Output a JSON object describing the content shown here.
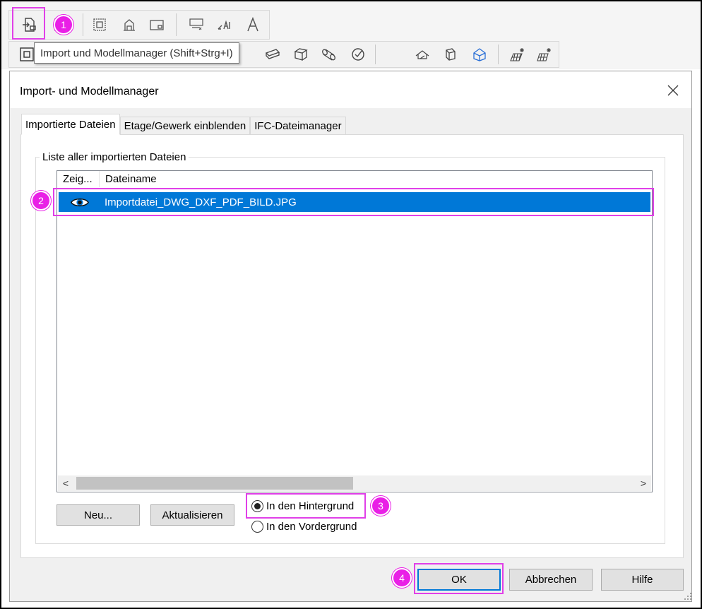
{
  "toolbar": {
    "tooltip": "Import und Modellmanager (Shift+Strg+I)",
    "row1_icons": [
      "import-icon",
      "copy-frame-icon",
      "floor-plan-icon",
      "frame-icon",
      "number-icon",
      "dimension-text-icon",
      "text-icon"
    ],
    "row2_icons": [
      "stamp-icon",
      "beam-icon",
      "box-icon",
      "cylinder-icon",
      "check-icon",
      "roof-icon",
      "cube-icon",
      "cut-icon",
      "grid-star-icon",
      "grid-star-2-icon"
    ]
  },
  "badges": {
    "one": "1",
    "two": "2",
    "three": "3",
    "four": "4"
  },
  "dialog": {
    "title": "Import- und Modellmanager",
    "tabs": [
      {
        "label": "Importierte Dateien",
        "active": true
      },
      {
        "label": "Etage/Gewerk einblenden",
        "active": false
      },
      {
        "label": "IFC-Dateimanager",
        "active": false
      }
    ],
    "group_label": "Liste aller importierten Dateien",
    "list": {
      "columns": [
        "Zeig...",
        "Dateiname"
      ],
      "rows": [
        {
          "visible_icon": "eye-icon",
          "filename": "Importdatei_DWG_DXF_PDF_BILD.JPG",
          "selected": true
        }
      ],
      "scroll_left": "<",
      "scroll_right": ">"
    },
    "buttons": {
      "new": "Neu...",
      "refresh": "Aktualisieren",
      "ok": "OK",
      "cancel": "Abbrechen",
      "help": "Hilfe"
    },
    "radios": {
      "background": "In den Hintergrund",
      "foreground": "In den Vordergrund",
      "selected": "background"
    }
  },
  "colors": {
    "highlight": "#e040e8",
    "badge": "#e91fe6",
    "selection": "#0078d7"
  }
}
